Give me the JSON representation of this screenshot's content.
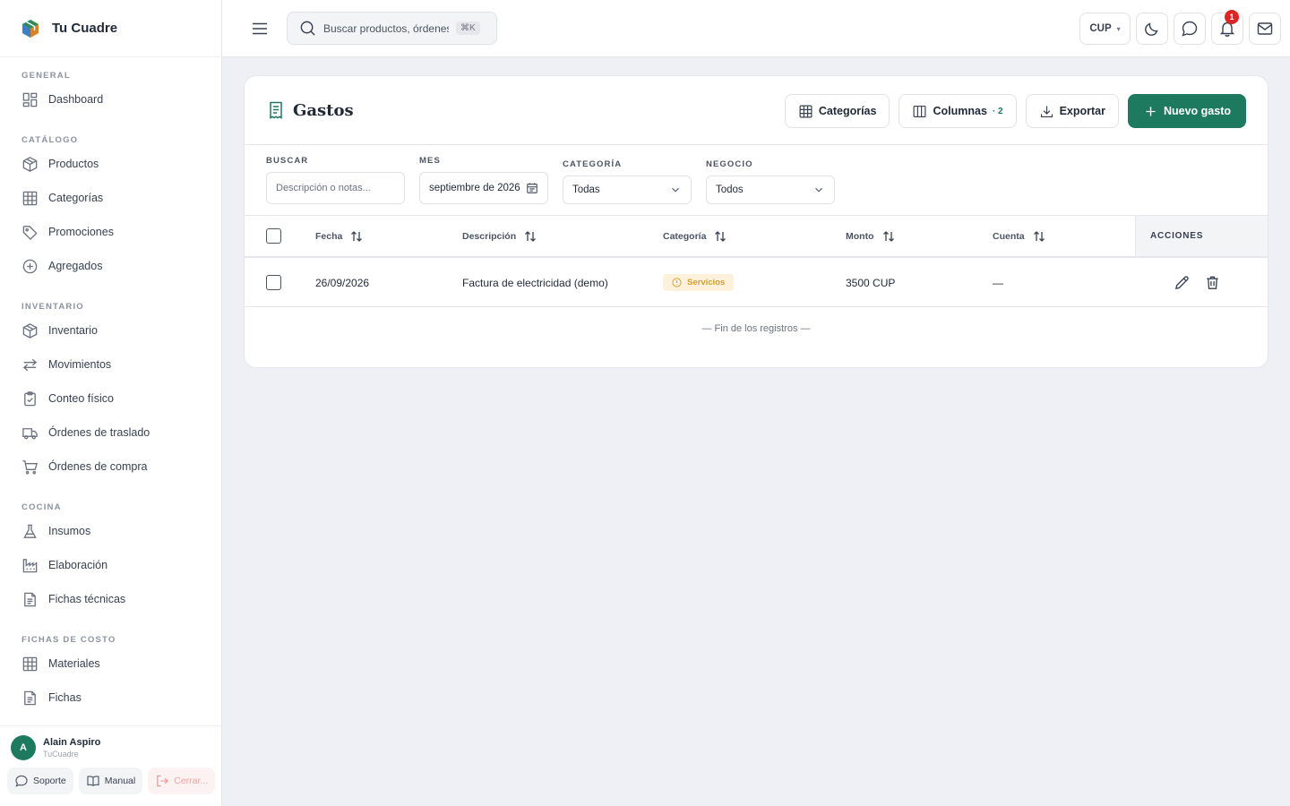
{
  "app": {
    "name": "Tu Cuadre"
  },
  "sidebar": {
    "sections": [
      {
        "title": "GENERAL",
        "items": [
          {
            "label": "Dashboard",
            "icon": "dashboard-icon"
          }
        ]
      },
      {
        "title": "CATÁLOGO",
        "items": [
          {
            "label": "Productos",
            "icon": "box-icon"
          },
          {
            "label": "Categorías",
            "icon": "grid-icon"
          },
          {
            "label": "Promociones",
            "icon": "tag-icon"
          },
          {
            "label": "Agregados",
            "icon": "plus-circle-icon"
          }
        ]
      },
      {
        "title": "INVENTARIO",
        "items": [
          {
            "label": "Inventario",
            "icon": "box-icon"
          },
          {
            "label": "Movimientos",
            "icon": "arrows-icon"
          },
          {
            "label": "Conteo físico",
            "icon": "clipboard-check-icon"
          },
          {
            "label": "Órdenes de traslado",
            "icon": "truck-icon"
          },
          {
            "label": "Órdenes de compra",
            "icon": "cart-icon"
          }
        ]
      },
      {
        "title": "COCINA",
        "items": [
          {
            "label": "Insumos",
            "icon": "flask-icon"
          },
          {
            "label": "Elaboración",
            "icon": "factory-icon"
          },
          {
            "label": "Fichas técnicas",
            "icon": "document-icon"
          }
        ]
      },
      {
        "title": "FICHAS DE COSTO",
        "items": [
          {
            "label": "Materiales",
            "icon": "grid-icon"
          },
          {
            "label": "Fichas",
            "icon": "document-icon"
          }
        ]
      }
    ]
  },
  "user": {
    "initial": "A",
    "name": "Alain Aspiro",
    "org": "TuCuadre",
    "support_label": "Soporte",
    "manual_label": "Manual",
    "logout_label": "Cerrar..."
  },
  "topbar": {
    "search_placeholder": "Buscar productos, órdenes",
    "shortcut": "⌘K",
    "currency": "CUP",
    "notifications_count": "1"
  },
  "page": {
    "title": "Gastos",
    "buttons": {
      "categories": "Categorías",
      "columns": "Columnas",
      "columns_count": "· 2",
      "export": "Exportar",
      "new": "Nuevo gasto"
    }
  },
  "filters": {
    "search": {
      "label": "BUSCAR",
      "placeholder": "Descripción o notas..."
    },
    "month": {
      "label": "MES",
      "value": "septiembre de 2026"
    },
    "category": {
      "label": "CATEGORÍA",
      "value": "Todas"
    },
    "business": {
      "label": "NEGOCIO",
      "value": "Todos"
    }
  },
  "table": {
    "headers": {
      "date": "Fecha",
      "description": "Descripción",
      "category": "Categoría",
      "amount": "Monto",
      "account": "Cuenta",
      "actions": "ACCIONES"
    },
    "rows": [
      {
        "date": "26/09/2026",
        "description": "Factura de electricidad (demo)",
        "category": "Servicios",
        "amount": "3500 CUP",
        "account": "—"
      }
    ],
    "end_note": "— Fin de los registros —"
  },
  "colors": {
    "accent": "#1e7a5e",
    "badge": "#dc2626",
    "pill_bg": "#fdf1dc",
    "pill_fg": "#d69e2e"
  }
}
